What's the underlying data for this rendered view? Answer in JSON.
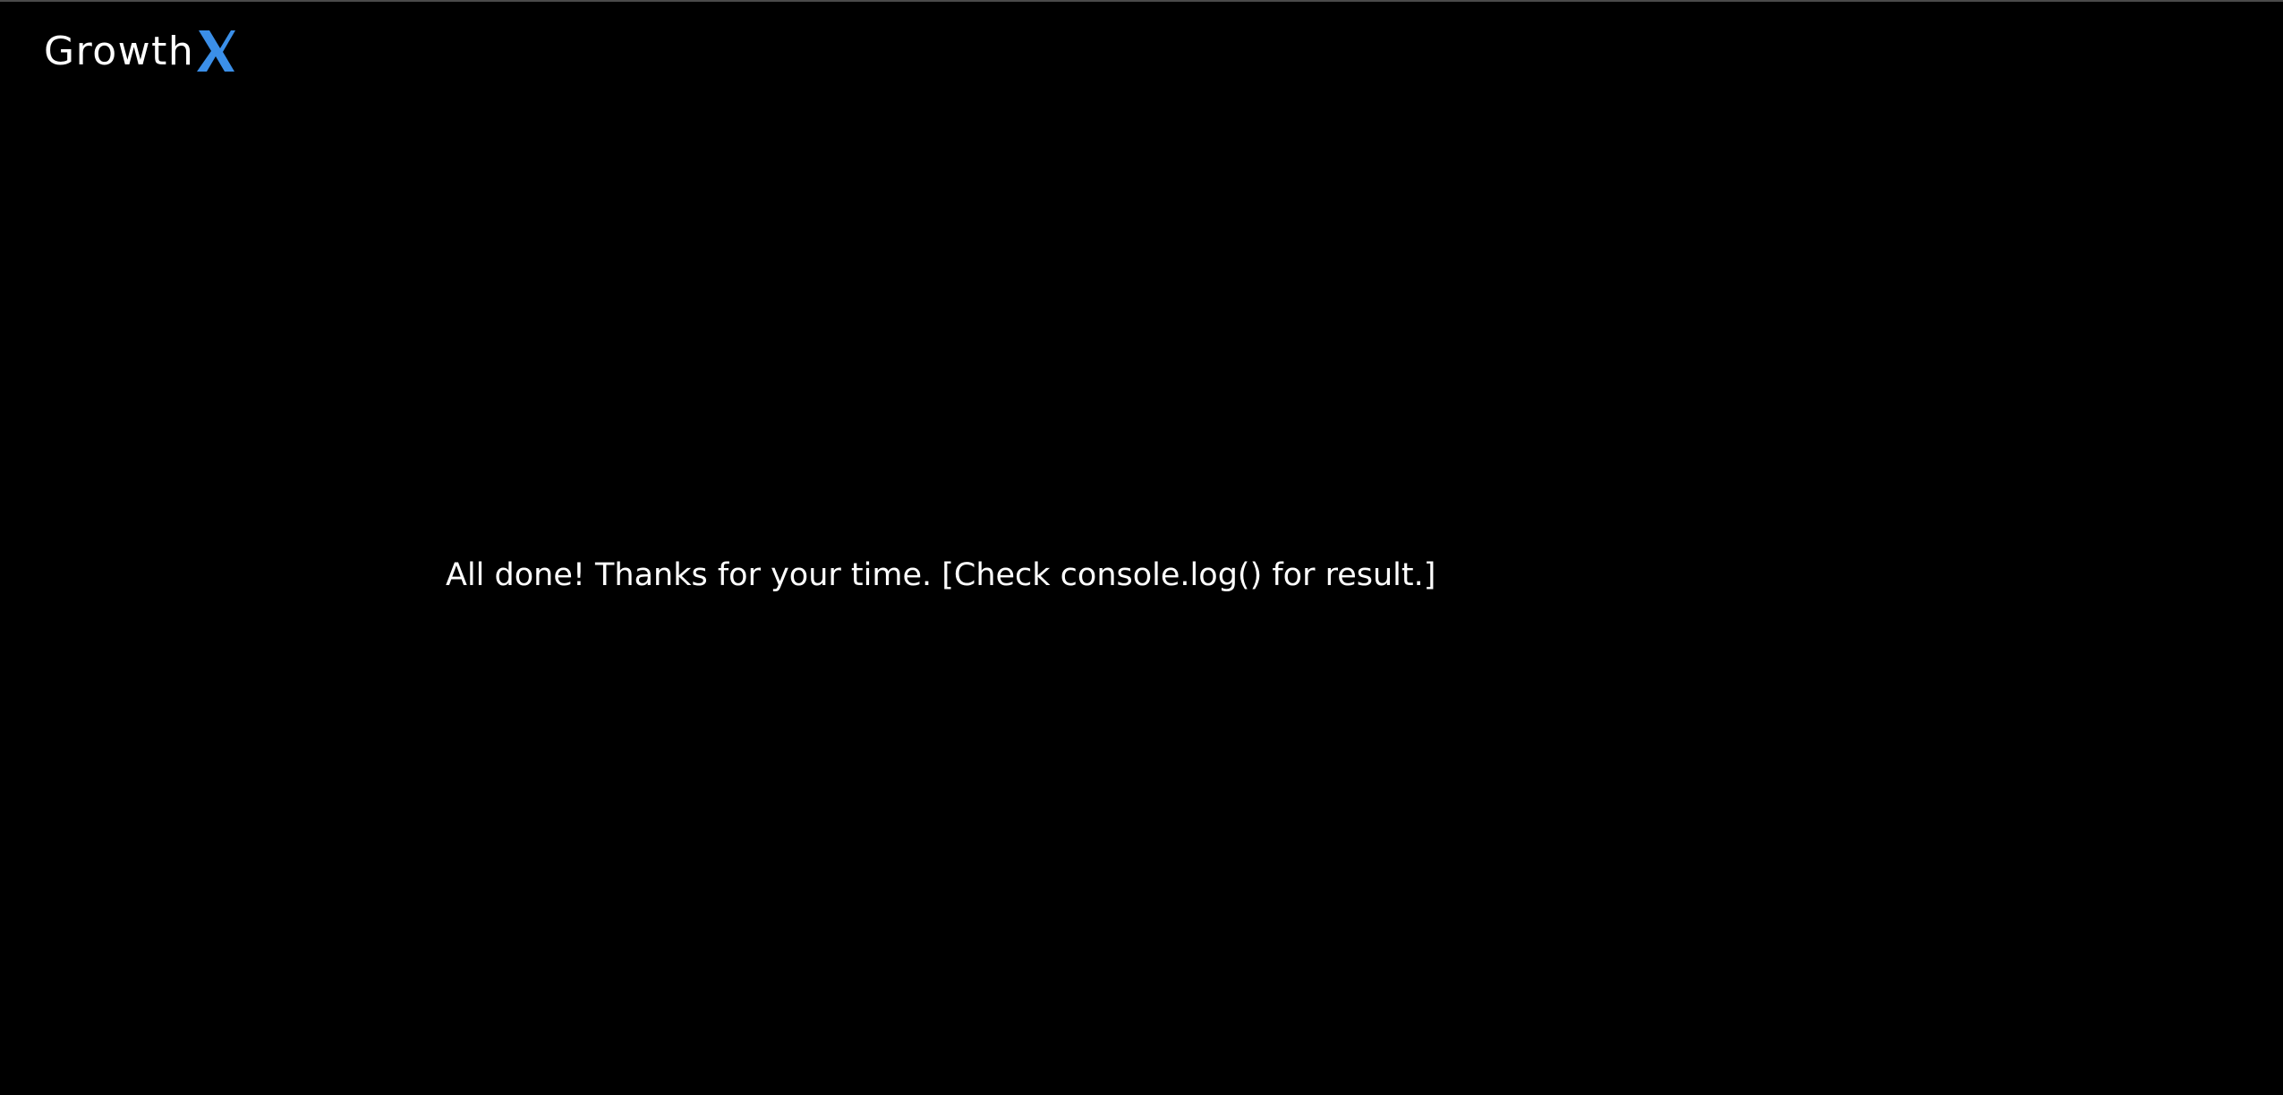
{
  "header": {
    "logo_text": "Growth",
    "logo_mark": "X",
    "logo_mark_icon": "x-mark-logo-icon",
    "logo_mark_color": "#3b8fe8"
  },
  "main": {
    "message": "All done! Thanks for your time. [Check console.log() for result.]"
  },
  "colors": {
    "background": "#000000",
    "text": "#ffffff"
  }
}
